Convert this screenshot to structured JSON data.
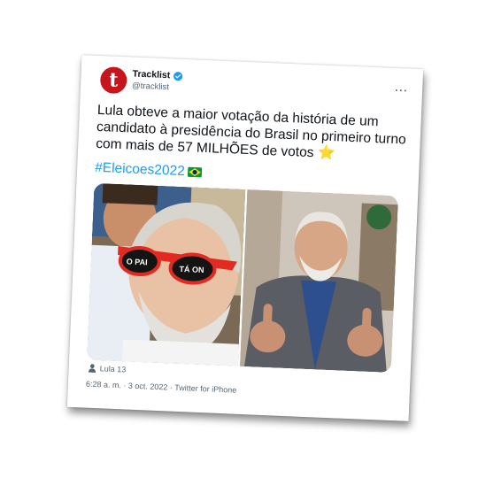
{
  "account": {
    "name": "Tracklist",
    "handle": "@tracklist",
    "avatar_letter": "t",
    "avatar_color": "#c4161c",
    "verified": true
  },
  "tweet": {
    "text": "Lula obteve a maior votação da história de um candidato à presidência do Brasil no primeiro turno com mais de 57 MILHÕES de votos",
    "emoji": "⭐",
    "hashtag": "#Eleicoes2022",
    "hashtag_emoji": "brazil-flag-icon"
  },
  "media": {
    "images": [
      {
        "description_icon": "photo-red-sunglasses",
        "sunglasses_text_left": "O PAI",
        "sunglasses_text_right": "TÁ ON"
      },
      {
        "description_icon": "photo-thumbs-up"
      }
    ]
  },
  "tags": {
    "icon": "person-icon",
    "label": "Lula 13"
  },
  "meta": {
    "text": "6:28 a. m. · 3 oct. 2022 · Twitter for iPhone"
  },
  "colors": {
    "link": "#1d9bf0",
    "text": "#0f1419",
    "muted": "#536471",
    "verified": "#1d9bf0"
  }
}
